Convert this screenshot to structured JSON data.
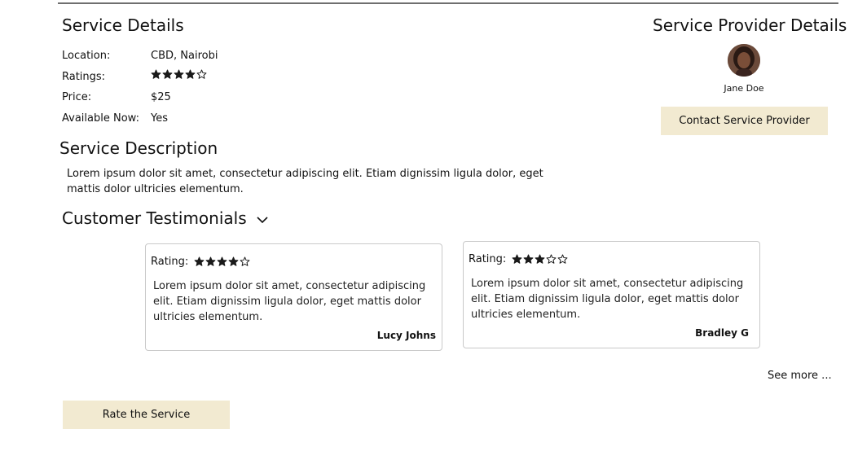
{
  "service_details": {
    "heading": "Service Details",
    "rows": [
      {
        "label": "Location:",
        "value": "CBD, Nairobi"
      },
      {
        "label": "Ratings:",
        "stars_filled": 4,
        "stars_total": 5
      },
      {
        "label": "Price:",
        "value": "$25"
      },
      {
        "label": "Available Now:",
        "value": "Yes"
      }
    ]
  },
  "provider": {
    "heading": "Service Provider Details",
    "name": "Jane Doe",
    "contact_label": "Contact Service Provider"
  },
  "description": {
    "heading": "Service Description",
    "text": "Lorem ipsum dolor sit amet, consectetur adipiscing elit. Etiam dignissim ligula dolor, eget mattis dolor ultricies elementum."
  },
  "testimonials": {
    "heading": "Customer Testimonials",
    "items": [
      {
        "rating_label": "Rating:",
        "stars_filled": 4,
        "stars_total": 5,
        "text": "Lorem ipsum dolor sit amet, consectetur adipiscing elit. Etiam dignissim ligula dolor, eget mattis dolor ultricies elementum.",
        "author": "Lucy Johns"
      },
      {
        "rating_label": "Rating:",
        "stars_filled": 3,
        "stars_total": 5,
        "text": "Lorem ipsum dolor sit amet, consectetur adipiscing elit. Etiam dignissim ligula dolor, eget mattis dolor ultricies elementum.",
        "author": "Bradley G"
      }
    ],
    "see_more": "See more ..."
  },
  "rate_button": "Rate the Service",
  "colors": {
    "button_bg": "#f2ead1",
    "star": "#1a1a1a",
    "card_border": "#c9c9c9"
  }
}
